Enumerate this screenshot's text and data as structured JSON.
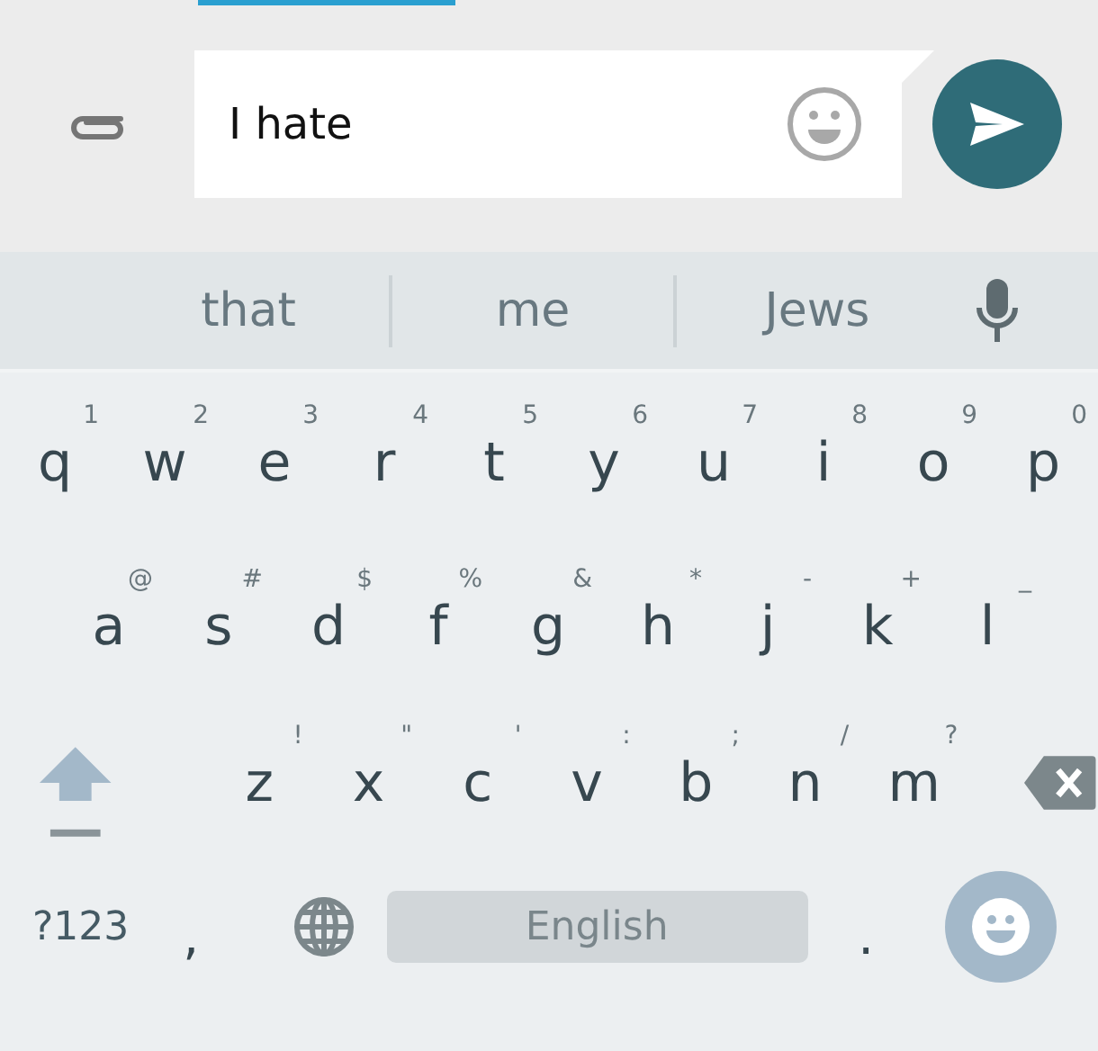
{
  "composer": {
    "value": "I hate"
  },
  "suggestions": [
    "that",
    "me",
    "Jews"
  ],
  "keyboard": {
    "rows": [
      [
        {
          "key": "q",
          "hint": "1"
        },
        {
          "key": "w",
          "hint": "2"
        },
        {
          "key": "e",
          "hint": "3"
        },
        {
          "key": "r",
          "hint": "4"
        },
        {
          "key": "t",
          "hint": "5"
        },
        {
          "key": "y",
          "hint": "6"
        },
        {
          "key": "u",
          "hint": "7"
        },
        {
          "key": "i",
          "hint": "8"
        },
        {
          "key": "o",
          "hint": "9"
        },
        {
          "key": "p",
          "hint": "0"
        }
      ],
      [
        {
          "key": "a",
          "hint": "@"
        },
        {
          "key": "s",
          "hint": "#"
        },
        {
          "key": "d",
          "hint": "$"
        },
        {
          "key": "f",
          "hint": "%"
        },
        {
          "key": "g",
          "hint": "&"
        },
        {
          "key": "h",
          "hint": "*"
        },
        {
          "key": "j",
          "hint": "-"
        },
        {
          "key": "k",
          "hint": "+"
        },
        {
          "key": "l",
          "hint": "_"
        }
      ],
      [
        {
          "key": "z",
          "hint": "!"
        },
        {
          "key": "x",
          "hint": "\""
        },
        {
          "key": "c",
          "hint": "'"
        },
        {
          "key": "v",
          "hint": ":"
        },
        {
          "key": "b",
          "hint": ";"
        },
        {
          "key": "n",
          "hint": "/"
        },
        {
          "key": "m",
          "hint": "?"
        }
      ]
    ],
    "symbols_key": "?123",
    "comma_key": ",",
    "space_key": "English",
    "period_key": "."
  }
}
